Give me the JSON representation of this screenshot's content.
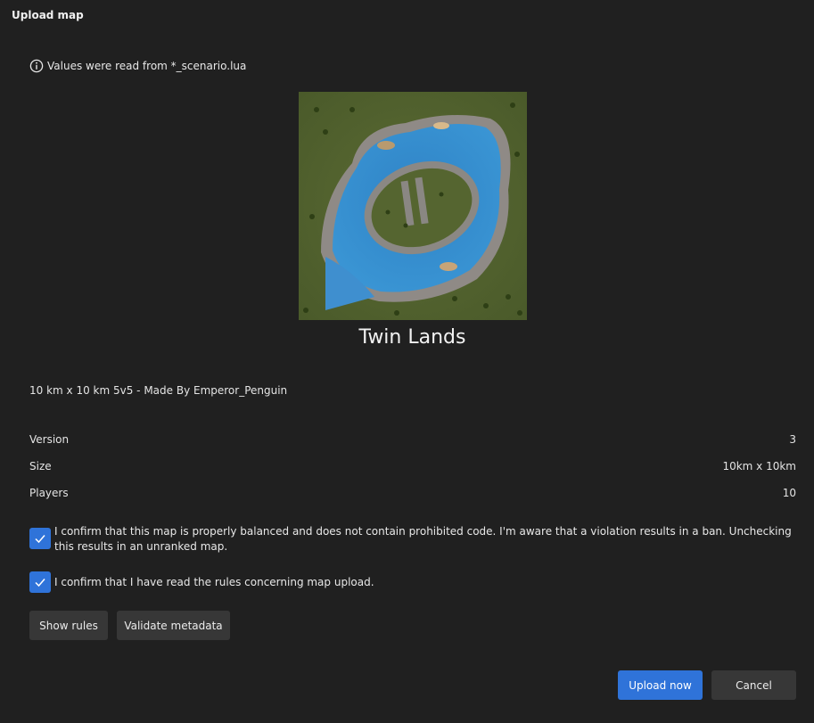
{
  "dialog": {
    "title": "Upload map"
  },
  "info": {
    "text": "Values were read from *_scenario.lua",
    "icon": "info-icon"
  },
  "map": {
    "name": "Twin Lands",
    "description": "10 km x 10 km 5v5 - Made By Emperor_Penguin",
    "preview_alt": "Map preview"
  },
  "properties": [
    {
      "label": "Version",
      "value": "3"
    },
    {
      "label": "Size",
      "value": "10km x 10km"
    },
    {
      "label": "Players",
      "value": "10"
    }
  ],
  "confirmations": [
    {
      "text": "I confirm that this map is properly balanced and does not contain prohibited code. I'm aware that a violation results in a ban. Unchecking this results in an unranked map.",
      "checked": true
    },
    {
      "text": "I confirm that I have read the rules concerning map upload.",
      "checked": true
    }
  ],
  "buttons": {
    "show_rules": "Show rules",
    "validate_metadata": "Validate metadata",
    "upload_now": "Upload now",
    "cancel": "Cancel"
  },
  "colors": {
    "background": "#202020",
    "accent": "#2f73d9",
    "button": "#373737"
  }
}
